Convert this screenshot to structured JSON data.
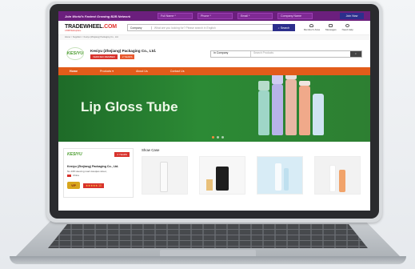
{
  "topbar": {
    "promo": "Join World's Fastest Growing B2B Network",
    "full_name_placeholder": "Full Name *",
    "phone_placeholder": "Phone *",
    "email_placeholder": "Email *",
    "company_placeholder": "Company Name",
    "join_label": "Join Now"
  },
  "header": {
    "logo_main": "TRADEWHEEL",
    "logo_tld": ".COM",
    "logo_sub": "A B2B Marketplace",
    "search_category": "Company",
    "search_placeholder": "What are you looking for? Please search in English",
    "search_button": "Search",
    "icons": [
      {
        "label": "Member's Area",
        "icon": "user-icon"
      },
      {
        "label": "Messages",
        "icon": "message-icon"
      },
      {
        "label": "Need Help",
        "icon": "help-icon"
      }
    ]
  },
  "breadcrumb": "Home > Suppliers > Kesiyu (Zhejiang) Packaging Co., Ltd.",
  "company": {
    "logo_text": "KESIYU",
    "name": "Kesiyu (Zhejiang) Packaging Co., Ltd.",
    "badge_verified": "VERIFIED MEMBER",
    "badge_years": "2 YEARS",
    "search_scope": "In Company",
    "search_placeholder": "Search Products"
  },
  "nav": {
    "items": [
      "Home",
      "Products",
      "About Us",
      "Contact Us"
    ]
  },
  "banner": {
    "title": "Lip Gloss Tube",
    "dots": 3,
    "active_dot": 1
  },
  "sidebar": {
    "logo_text": "KESIYU",
    "years": "2 YEARS",
    "name": "Kesiyu (Zhejiang) Packaging Co., Ltd.",
    "address": "No.168 xiaoxing road xiaoqiao street,",
    "country": "China",
    "vip_label": "VIP",
    "stars": "★★★★★ 10"
  },
  "showcase": {
    "heading": "Show Case"
  },
  "colors": {
    "topbar": "#6b1f7d",
    "nav": "#e25c1a",
    "banner": "#2c8a35",
    "accent_red": "#d8332d",
    "button_blue": "#2c2f8c"
  }
}
